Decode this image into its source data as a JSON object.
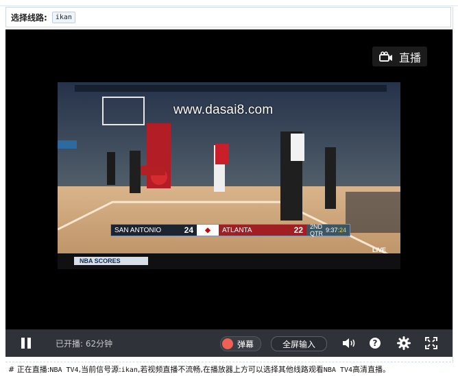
{
  "route_bar": {
    "label": "选择线路:",
    "options": [
      "ikan"
    ]
  },
  "player": {
    "live_button": {
      "label": "直播",
      "icon": "camera-icon"
    },
    "video": {
      "watermark": "www.dasai8.com",
      "scoreboard": {
        "away_team": "SAN ANTONIO",
        "away_score": "24",
        "home_team": "ATLANTA",
        "home_score": "22",
        "period": "2ND QTR",
        "clock": "9:37",
        "shot_clock": ":24"
      },
      "ticker_label": "NBA SCORES",
      "corner_badge": "LIVE"
    },
    "controls": {
      "live_duration": "已开播: 62分钟",
      "danmu_label": "弹幕",
      "fullscreen_input_label": "全屏输入",
      "icons": [
        "pause-icon",
        "volume-icon",
        "help-icon",
        "settings-icon",
        "fullscreen-icon"
      ]
    }
  },
  "notice": {
    "prefix": "# 正在直播:",
    "channel": "NBA TV4",
    "mid1": ",当前信号源:",
    "source": "ikan",
    "mid2": ",若视频直播不流畅,在播放器上方可以选择其他线路观看",
    "channel2": "NBA TV4",
    "suffix": "高清直播。"
  },
  "colors": {
    "player_bg": "#000000",
    "control_bar": "#2f3238",
    "danmu_indicator": "#f06055",
    "route_chip_border": "#b9cde3"
  }
}
